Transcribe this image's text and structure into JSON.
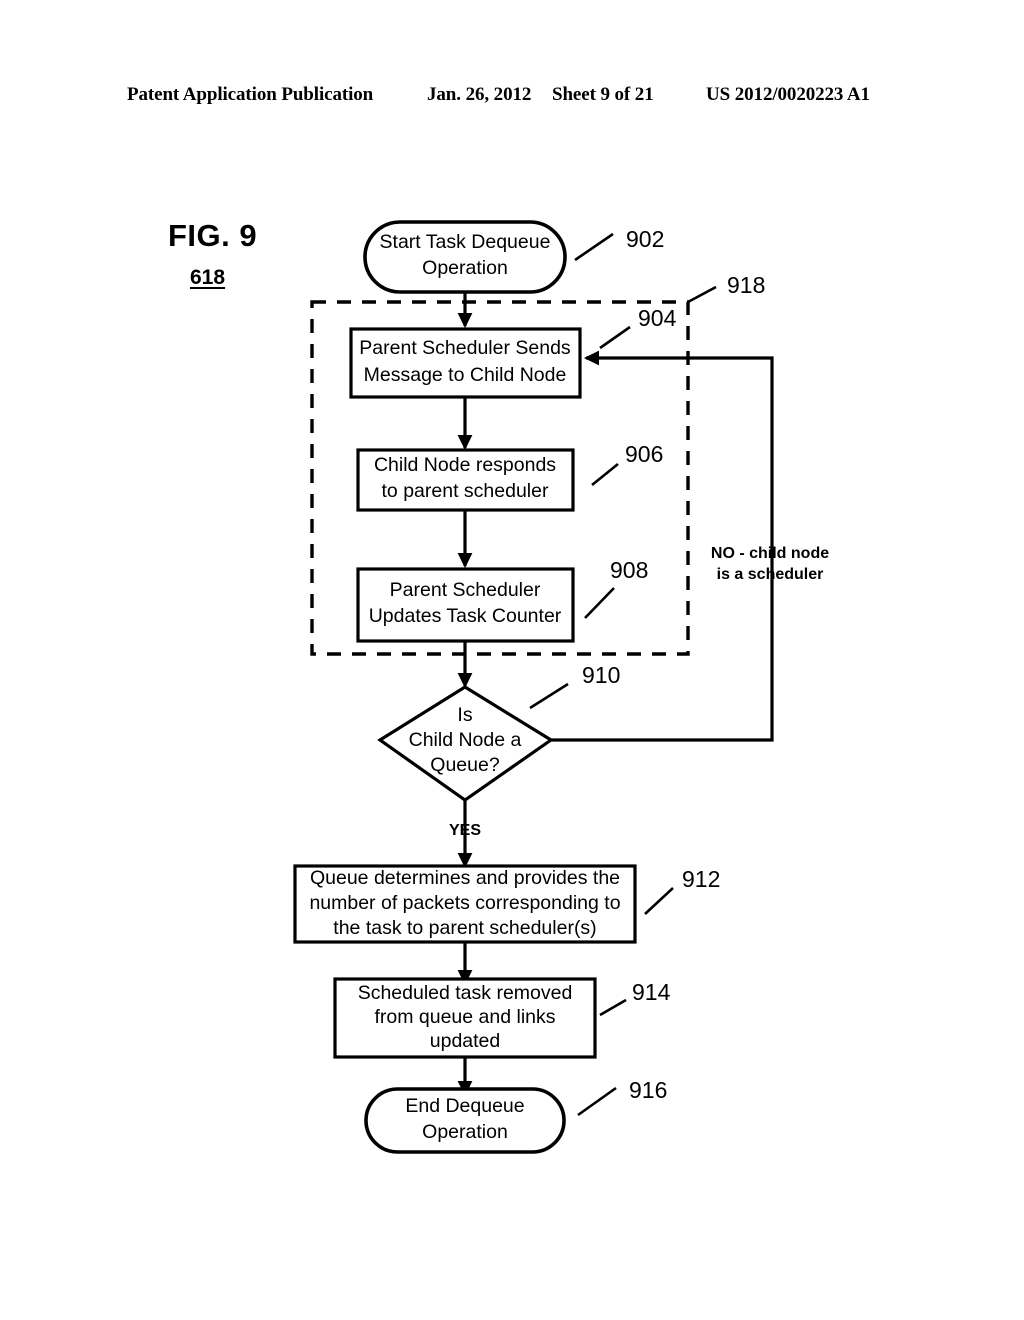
{
  "header": {
    "publication": "Patent Application Publication",
    "date": "Jan. 26, 2012",
    "sheet": "Sheet 9 of 21",
    "patent_number": "US 2012/0020223 A1"
  },
  "figure": {
    "title": "FIG. 9",
    "reference": "618"
  },
  "flowchart": {
    "nodes": [
      {
        "id": "start",
        "ref": "902",
        "type": "terminator",
        "lines": [
          "Start Task Dequeue",
          "Operation"
        ]
      },
      {
        "id": "send-message",
        "ref": "904",
        "type": "process",
        "lines": [
          "Parent Scheduler Sends",
          "Message to Child Node"
        ]
      },
      {
        "id": "child-responds",
        "ref": "906",
        "type": "process",
        "lines": [
          "Child Node responds",
          "to parent scheduler"
        ]
      },
      {
        "id": "update-counter",
        "ref": "908",
        "type": "process",
        "lines": [
          "Parent Scheduler",
          "Updates Task Counter"
        ]
      },
      {
        "id": "is-queue",
        "ref": "910",
        "type": "decision",
        "lines": [
          "Is",
          "Child Node a",
          "Queue?"
        ]
      },
      {
        "id": "queue-provides",
        "ref": "912",
        "type": "process",
        "lines": [
          "Queue determines and provides the",
          "number of packets corresponding to",
          "the task to parent scheduler(s)"
        ]
      },
      {
        "id": "task-removed",
        "ref": "914",
        "type": "process",
        "lines": [
          "Scheduled task removed",
          "from queue and links",
          "updated"
        ]
      },
      {
        "id": "end",
        "ref": "916",
        "type": "terminator",
        "lines": [
          "End Dequeue",
          "Operation"
        ]
      }
    ],
    "group": {
      "id": "dashed-group",
      "ref": "918"
    },
    "branches": {
      "yes_label": "YES",
      "no_label_lines": [
        "NO - child node",
        "is a scheduler"
      ]
    },
    "colors": {
      "stroke": "#000000",
      "fill": "#ffffff",
      "background": "#ffffff"
    }
  }
}
